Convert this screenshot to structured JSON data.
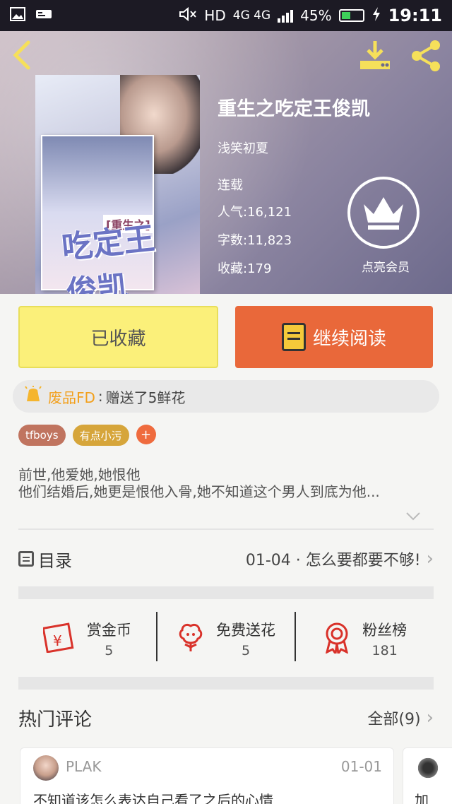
{
  "status_bar": {
    "hd": "HD",
    "net": "4G 4G",
    "battery_pct": "45%",
    "battery_level": 0.45,
    "time": "19:11"
  },
  "book": {
    "title": "重生之吃定王俊凯",
    "author": "浅笑初夏",
    "status": "连载",
    "popularity": "人气:16,121",
    "words": "字数:11,823",
    "favorites": "收藏:179",
    "vip_label": "点亮会员",
    "cover": {
      "title_text": "吃定王俊凯",
      "series_text": "[重生之]"
    }
  },
  "actions": {
    "collected_label": "已收藏",
    "continue_label": "继续阅读"
  },
  "gift": {
    "user": "废品FD",
    "separator": ":",
    "message": "赠送了5鲜花"
  },
  "tags": [
    {
      "label": "tfboys",
      "color": "#c0745f"
    },
    {
      "label": "有点小污",
      "color": "#d6a53a"
    }
  ],
  "tag_add": "+",
  "summary": {
    "line1": "前世,他爱她,她恨他",
    "line2": "他们结婚后,她更是恨他入骨,她不知道这个男人到底为他..."
  },
  "toc": {
    "label": "目录",
    "latest": "01-04 · 怎么要都要不够!"
  },
  "stats": [
    {
      "label": "赏金币",
      "value": "5",
      "icon": "red-envelope-icon"
    },
    {
      "label": "免费送花",
      "value": "5",
      "icon": "flower-icon"
    },
    {
      "label": "粉丝榜",
      "value": "181",
      "icon": "medal-icon"
    }
  ],
  "comments": {
    "title": "热门评论",
    "all_label": "全部(9)",
    "items": [
      {
        "user": "PLAK",
        "date": "01-01",
        "text": "不知道该怎么表达自己看了之后的心情"
      },
      {
        "text": "加"
      }
    ]
  },
  "colors": {
    "accent_yellow": "#fbf07a",
    "accent_orange": "#e9683a",
    "gift_user": "#f2a01d"
  }
}
